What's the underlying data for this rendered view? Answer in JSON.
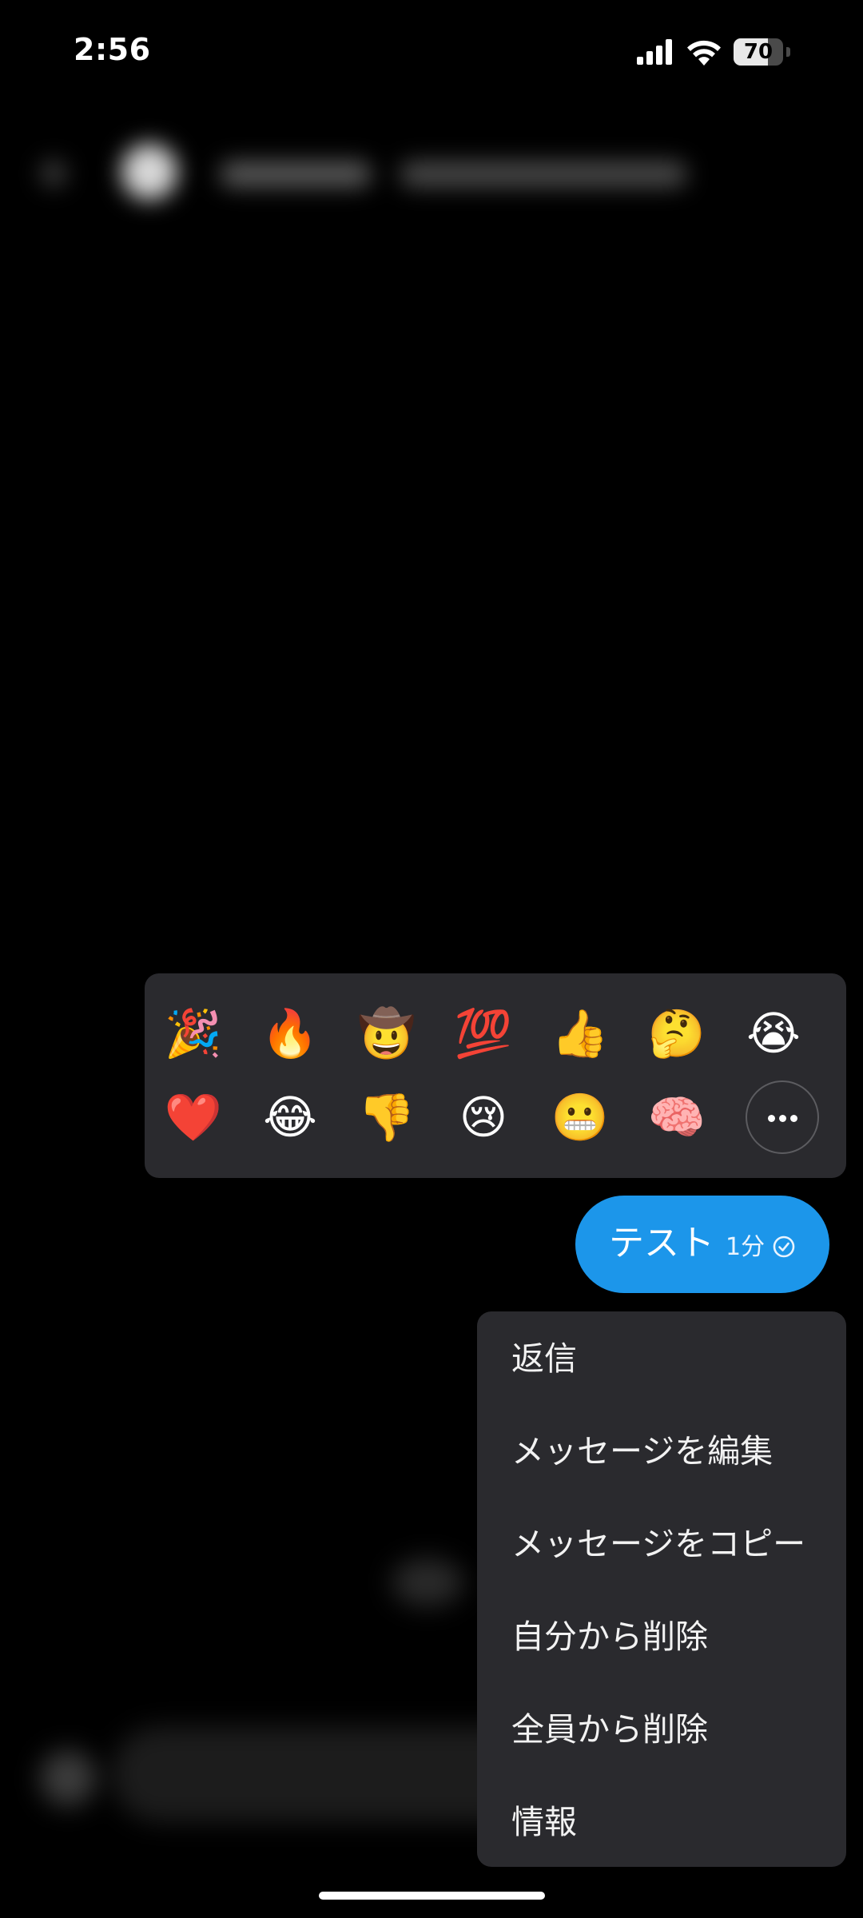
{
  "status_bar": {
    "time": "2:56",
    "battery_level": "70",
    "icons": [
      "signal-icon",
      "wifi-icon",
      "battery-icon"
    ]
  },
  "reactions": {
    "row1": [
      "🎉",
      "🔥",
      "🤠",
      "💯",
      "👍",
      "🤔",
      "😭"
    ],
    "row2": [
      "❤️",
      "😂",
      "👎",
      "😢",
      "😬",
      "🧠"
    ],
    "more_icon": "more-horizontal-icon"
  },
  "message": {
    "text": "テスト",
    "time": "1分",
    "status_icon": "sent-check-icon",
    "bubble_color": "#1c96ea"
  },
  "context_menu": {
    "items": [
      {
        "label": "返信"
      },
      {
        "label": "メッセージを編集"
      },
      {
        "label": "メッセージをコピー"
      },
      {
        "label": "自分から削除"
      },
      {
        "label": "全員から削除"
      },
      {
        "label": "情報"
      }
    ]
  },
  "colors": {
    "background": "#000000",
    "panel": "#2a2a2e",
    "accent": "#1c96ea"
  }
}
